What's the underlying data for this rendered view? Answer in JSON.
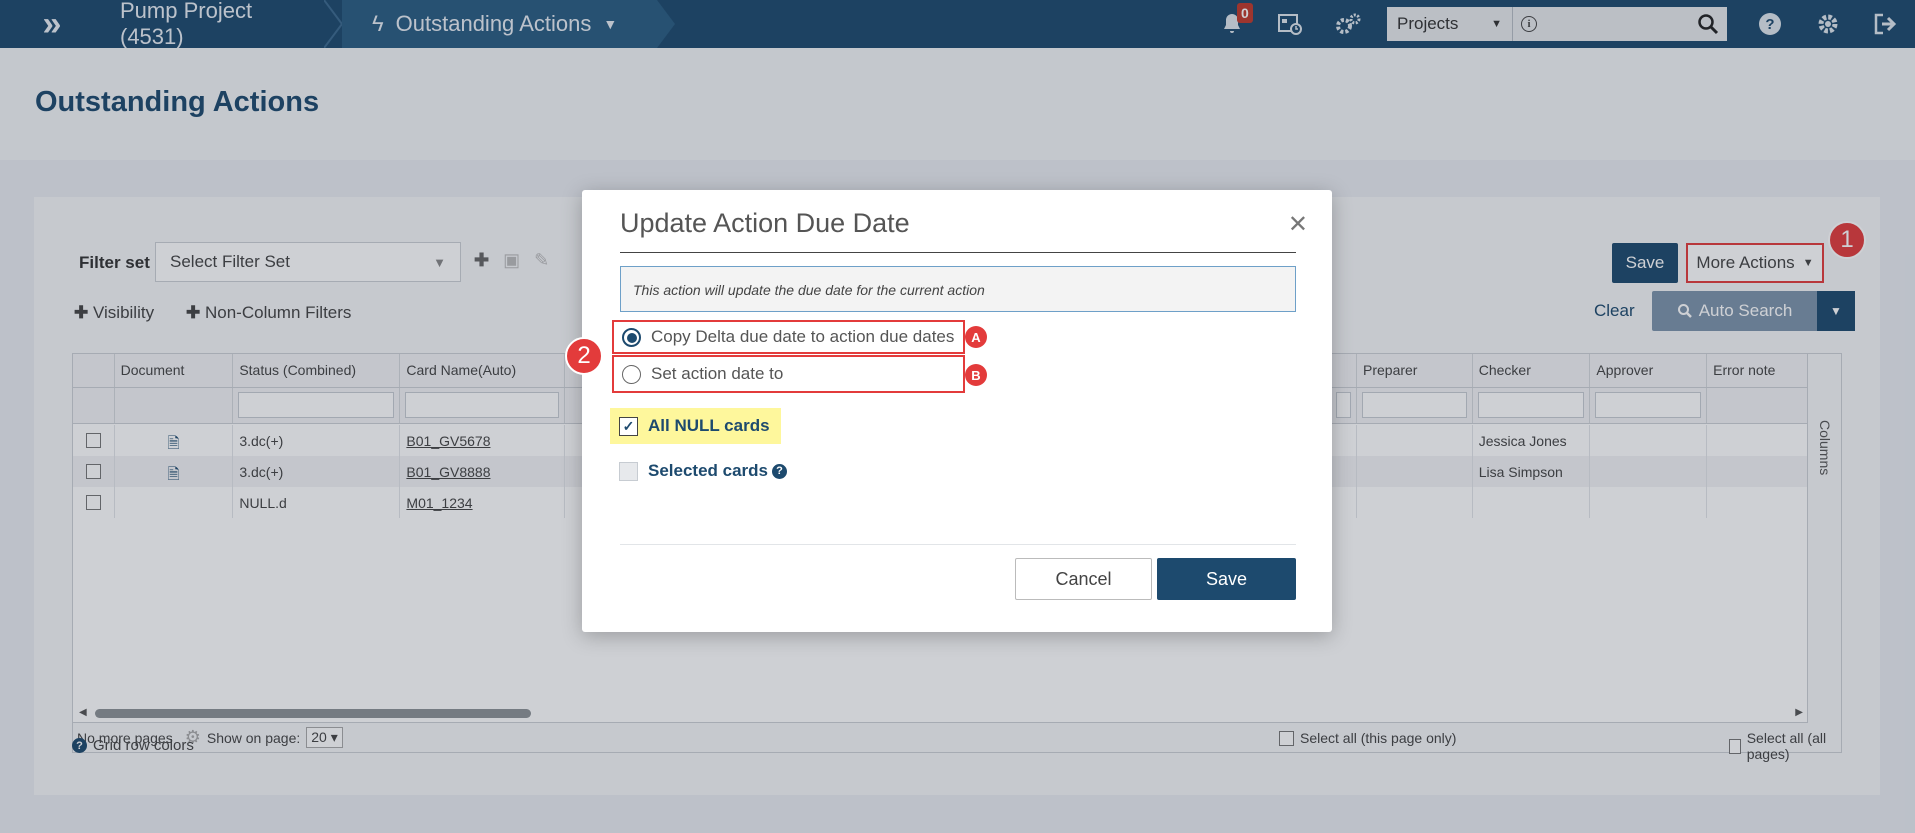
{
  "topbar": {
    "logo": "»",
    "project": "Pump Project (4531)",
    "section": "Outstanding Actions",
    "notification_count": "0",
    "search_scope": "Projects"
  },
  "page": {
    "title": "Outstanding Actions"
  },
  "filter": {
    "label": "Filter set",
    "placeholder": "Select Filter Set",
    "visibility": "Visibility",
    "non_column_filters": "Non-Column Filters"
  },
  "actions": {
    "save": "Save",
    "more_actions": "More Actions",
    "clear": "Clear",
    "auto_search": "Auto Search"
  },
  "grid": {
    "columns_left": [
      "",
      "Document",
      "Status (Combined)",
      "Card Name(Auto)",
      ""
    ],
    "columns_right": [
      "",
      "Preparer",
      "Checker",
      "Approver",
      "Error note"
    ],
    "rows": [
      {
        "status": "3.dc(+)",
        "card": "B01_GV5678",
        "checker": "Jessica Jones"
      },
      {
        "status": "3.dc(+)",
        "card": "B01_GV8888",
        "checker": "Lisa Simpson"
      },
      {
        "status": "NULL.d",
        "card": "M01_1234",
        "checker": ""
      }
    ],
    "columns_toggle": "Columns"
  },
  "footer": {
    "no_more_pages": "No more pages",
    "show_on_page": "Show on page:",
    "page_size": "20",
    "select_page": "Select all (this page only)",
    "select_all": "Select all (all pages)",
    "grid_row_colors": "Grid row colors"
  },
  "modal": {
    "title": "Update Action Due Date",
    "info": "This action will update the due date for the current action",
    "option_a": "Copy Delta due date to action due dates",
    "option_b": "Set action date to",
    "tag_a": "A",
    "tag_b": "B",
    "all_null": "All NULL cards",
    "selected": "Selected cards",
    "cancel": "Cancel",
    "save": "Save"
  },
  "steps": {
    "one": "1",
    "two": "2"
  }
}
